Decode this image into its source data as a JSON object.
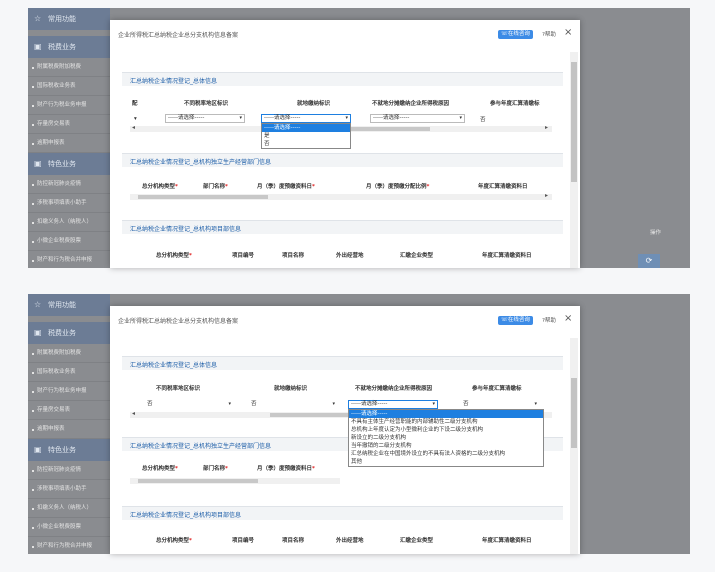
{
  "sidebar": {
    "common": "常用功能",
    "tax": "税费业务",
    "tax_items": [
      "附属税费附加税费",
      "国际税收业务表",
      "财产行为税业务申报",
      "存量房交易表",
      "逾期申报表"
    ],
    "feature": "特色业务",
    "feature_items": [
      "防控新冠肺炎疫情",
      "涉税事项填表小助手",
      "扣缴义务人（纳税人）",
      "小微企业税费股票",
      "财产和行为税合并申报"
    ]
  },
  "bg": {
    "op_label": "操作"
  },
  "modal": {
    "title": "企业所得税汇总纳税企业总分支机构信息备案",
    "online_btn": "在线咨询",
    "help": "帮助",
    "close": "×"
  },
  "section1": {
    "title": "汇总纳税企业情况登记_总体信息"
  },
  "section2": {
    "title": "汇总纳税企业情况登记_总机构独立生产经营部门信息"
  },
  "section3": {
    "title": "汇总纳税企业情况登记_总机构项目部信息"
  },
  "s1": {
    "col_pei": "配",
    "col_a": "不同税率地区标识",
    "col_b": "就地缴纳标识",
    "col_c": "不就地分摊缴纳企业所得税原因",
    "col_d": "参与年度汇算清缴标",
    "dash": "▾",
    "choose": "-----请选择-----",
    "no": "否"
  },
  "s2": {
    "col_a": "总分机构类型",
    "col_b": "部门名称",
    "col_c": "月（季）度预缴资料日",
    "col_d": "月（季）度预缴分配比例",
    "col_e": "年度汇算清缴资料日"
  },
  "s3": {
    "col_a": "总分机构类型",
    "col_b": "项目编号",
    "col_c": "项目名称",
    "col_d": "外出经营地",
    "col_e": "汇缴企业类型",
    "col_f": "年度汇算清缴资料日"
  },
  "dropdown1": [
    "-----请选择-----",
    "是",
    "否"
  ],
  "dropdown2": [
    "-----请选择-----",
    "不具有主体生产经营职能的内部辅助性二级分支机构",
    "总机构上年度认定为小型微利企业的下设二级分支机构",
    "新设立的二级分支机构",
    "当年撤销的二级分支机构",
    "汇总纳税企业在中国境外设立的不具有法人资格的二级分支机构",
    "其他"
  ],
  "colors": {
    "accent": "#1e7fe0",
    "section_title": "#1d5ea8",
    "required": "#e02020"
  }
}
